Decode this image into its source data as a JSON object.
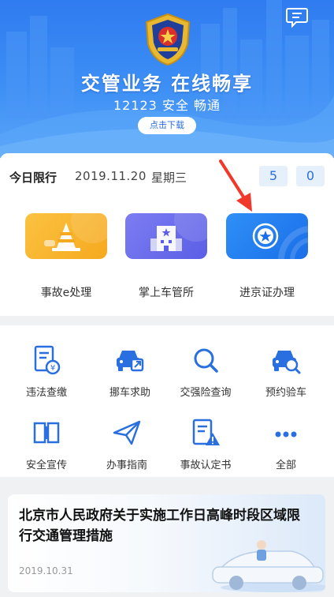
{
  "banner": {
    "title": "交管业务 在线畅享",
    "subtitle": "12123 安全 畅通",
    "download_button": "点击下载",
    "message_icon": "message-icon"
  },
  "restriction": {
    "label": "今日限行",
    "date": "2019.11.20",
    "weekday": "星期三",
    "numbers": [
      "5",
      "0"
    ]
  },
  "top_services": [
    {
      "label": "事故e处理",
      "icon": "traffic-cone-icon",
      "color": "#f8b32c"
    },
    {
      "label": "掌上车管所",
      "icon": "building-icon",
      "color": "#6a6cec"
    },
    {
      "label": "进京证办理",
      "icon": "badge-star-icon",
      "color": "#2584f2"
    }
  ],
  "grid": [
    {
      "label": "违法查缴",
      "icon": "ticket-yen-icon"
    },
    {
      "label": "挪车求助",
      "icon": "car-move-icon"
    },
    {
      "label": "交强险查询",
      "icon": "search-icon"
    },
    {
      "label": "预约验车",
      "icon": "car-inspect-icon"
    },
    {
      "label": "安全宣传",
      "icon": "book-icon"
    },
    {
      "label": "办事指南",
      "icon": "paper-plane-icon"
    },
    {
      "label": "事故认定书",
      "icon": "document-warning-icon"
    },
    {
      "label": "全部",
      "icon": "more-dots-icon"
    }
  ],
  "news": {
    "title": "北京市人民政府关于实施工作日高峰时段区域限行交通管理措施",
    "date": "2019.10.31"
  },
  "colors": {
    "brand_blue": "#2a6fe0",
    "banner_blue": "#3d8ff5",
    "annotation_arrow": "#f0392b"
  }
}
